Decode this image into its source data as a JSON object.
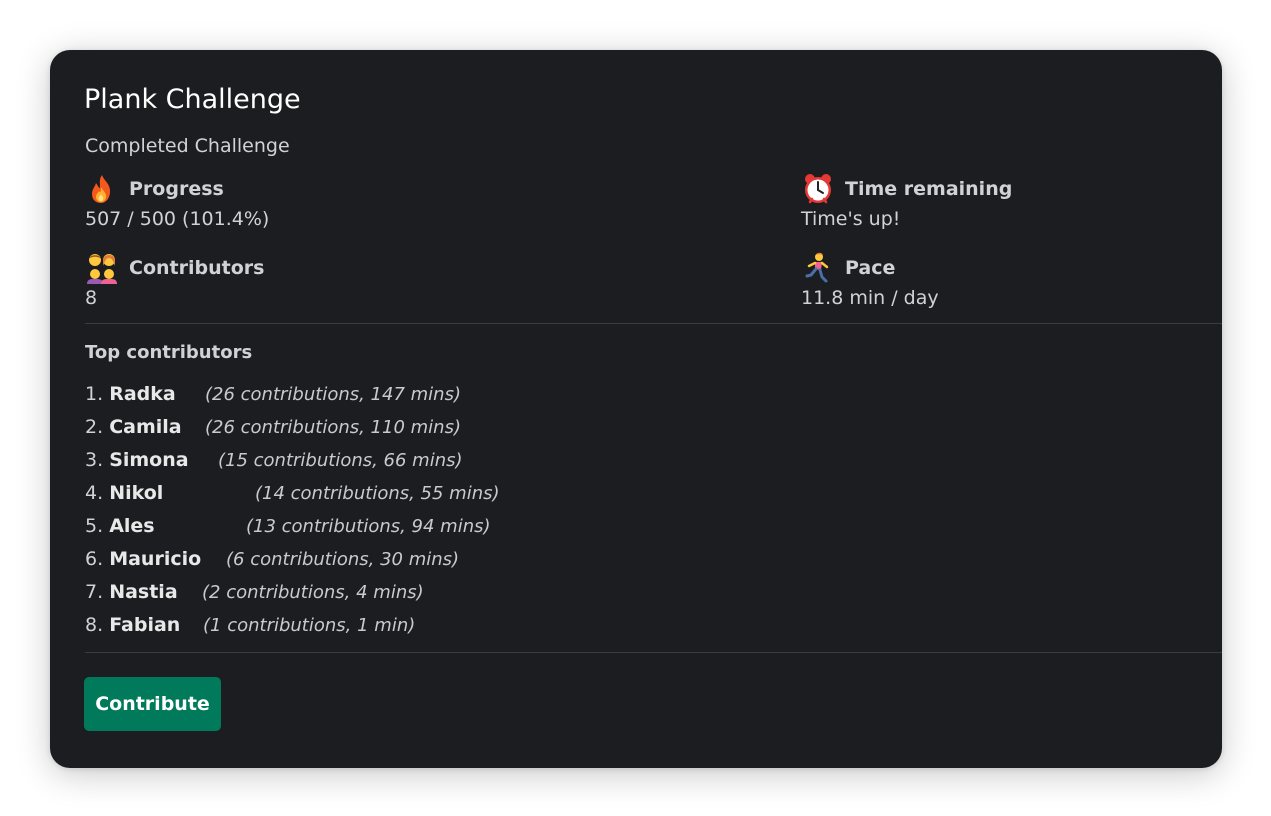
{
  "card": {
    "title": "Plank Challenge",
    "subtitle": "Completed Challenge"
  },
  "fields": {
    "progress": {
      "icon": "fire-icon",
      "label": "Progress",
      "value": "507 / 500 (101.4%)"
    },
    "time_remaining": {
      "icon": "alarm-clock-icon",
      "label": "Time remaining",
      "value": "Time's up!"
    },
    "contributors": {
      "icon": "family-icon",
      "label": "Contributors",
      "value": "8"
    },
    "pace": {
      "icon": "running-person-icon",
      "label": "Pace",
      "value": "11.8 min / day"
    }
  },
  "top_contributors": {
    "title": "Top contributors",
    "items": [
      {
        "rank": "1.",
        "name": "Radka",
        "detail": "(26 contributions, 147 mins)"
      },
      {
        "rank": "2.",
        "name": "Camila",
        "detail": "(26 contributions, 110 mins)"
      },
      {
        "rank": "3.",
        "name": "Simona",
        "detail": "(15 contributions, 66 mins)"
      },
      {
        "rank": "4.",
        "name": "Nikol",
        "detail": "(14 contributions, 55 mins)"
      },
      {
        "rank": "5.",
        "name": "Ales",
        "detail": "(13 contributions, 94 mins)"
      },
      {
        "rank": "6.",
        "name": "Mauricio",
        "detail": "(6 contributions, 30 mins)"
      },
      {
        "rank": "7.",
        "name": "Nastia",
        "detail": "(2 contributions, 4 mins)"
      },
      {
        "rank": "8.",
        "name": "Fabian",
        "detail": "(1 contributions, 1 min)"
      }
    ]
  },
  "actions": {
    "contribute_label": "Contribute"
  },
  "colors": {
    "card_background": "#1b1d21",
    "button_background": "#007a5a",
    "divider": "#3a3c40"
  }
}
